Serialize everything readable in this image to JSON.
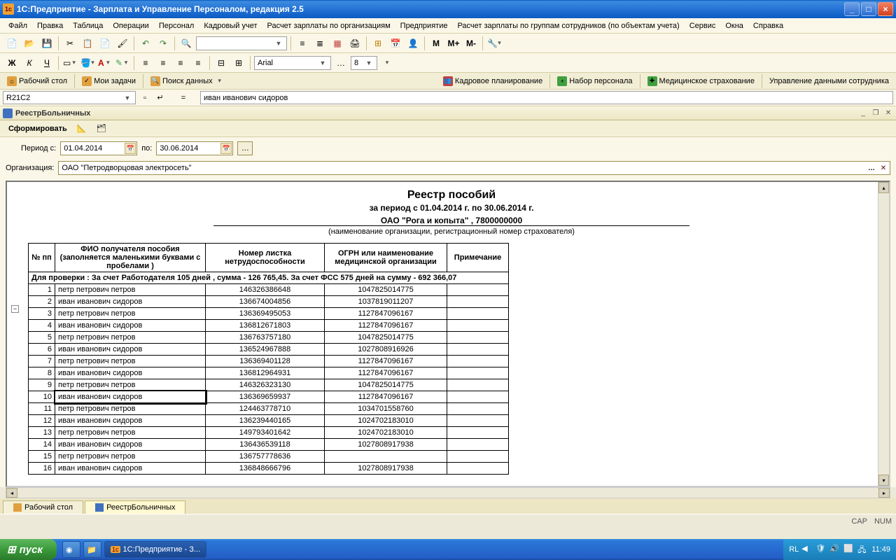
{
  "titlebar": {
    "text": "1С:Предприятие - Зарплата и Управление Персоналом, редакция 2.5"
  },
  "menu": {
    "items": [
      "Файл",
      "Правка",
      "Таблица",
      "Операции",
      "Персонал",
      "Кадровый учет",
      "Расчет зарплаты по организациям",
      "Предприятие",
      "Расчет зарплаты по группам сотрудников (по объектам учета)",
      "Сервис",
      "Окна",
      "Справка"
    ]
  },
  "fontcombo": {
    "name": "Arial",
    "size": "8"
  },
  "mtext": {
    "m": "M",
    "mplus": "M+",
    "mminus": "M-"
  },
  "tabs": {
    "desktop": "Рабочий стол",
    "tasks": "Мои задачи",
    "search": "Поиск данных",
    "plan": "Кадровое планирование",
    "recruit": "Набор персонала",
    "insurance": "Медицинское страхование",
    "empmgmt": "Управление данными сотрудника"
  },
  "cell": {
    "ref": "R21C2",
    "formula": "иван иванович сидоров",
    "eq": "="
  },
  "subwin": {
    "title": "РеестрБольничных"
  },
  "formbar": {
    "generate": "Сформировать"
  },
  "period": {
    "label": "Период с:",
    "from": "01.04.2014",
    "to_label": "по:",
    "to": "30.06.2014"
  },
  "org": {
    "label": "Организация:",
    "value": "ОАО \"Петродворцовая электросеть\""
  },
  "report": {
    "title": "Реестр пособий",
    "subtitle": "за период с 01.04.2014 г. по 30.06.2014 г.",
    "company": "ОАО \"Рога и копыта\" , 7800000000",
    "company_desc": "(наименование организации, регистрационный номер страхователя)",
    "headers": {
      "num": "№ пп",
      "fio": "ФИО  получателя пособия (заполняется маленькими буквами с пробелами )",
      "leaf": "Номер  листка нетрудоспособности",
      "ogrn": "ОГРН или наименование медицинской организации",
      "note": "Примечание"
    },
    "checkrow": "Для проверки : За счет Работодателя 105 дней , сумма - 126 765,45.  За счет ФСС 575 дней на сумму - 692 366,07",
    "rows": [
      {
        "n": "1",
        "fio": "петр петрович петров",
        "leaf": "146326386648",
        "ogrn": "1047825014775",
        "note": ""
      },
      {
        "n": "2",
        "fio": "иван иванович сидоров",
        "leaf": "136674004856",
        "ogrn": "1037819011207",
        "note": ""
      },
      {
        "n": "3",
        "fio": "петр петрович петров",
        "leaf": "136369495053",
        "ogrn": "1127847096167",
        "note": ""
      },
      {
        "n": "4",
        "fio": "иван иванович сидоров",
        "leaf": "136812671803",
        "ogrn": "1127847096167",
        "note": ""
      },
      {
        "n": "5",
        "fio": "петр петрович петров",
        "leaf": "136763757180",
        "ogrn": "1047825014775",
        "note": ""
      },
      {
        "n": "6",
        "fio": "иван иванович сидоров",
        "leaf": "136524967888",
        "ogrn": "1027808916926",
        "note": ""
      },
      {
        "n": "7",
        "fio": "петр петрович петров",
        "leaf": "136369401128",
        "ogrn": "1127847096167",
        "note": ""
      },
      {
        "n": "8",
        "fio": "иван иванович сидоров",
        "leaf": "136812964931",
        "ogrn": "1127847096167",
        "note": ""
      },
      {
        "n": "9",
        "fio": "петр петрович петров",
        "leaf": "146326323130",
        "ogrn": "1047825014775",
        "note": ""
      },
      {
        "n": "10",
        "fio": "иван иванович сидоров",
        "leaf": "136369659937",
        "ogrn": "1127847096167",
        "note": ""
      },
      {
        "n": "11",
        "fio": "петр петрович петров",
        "leaf": "124463778710",
        "ogrn": "1034701558760",
        "note": ""
      },
      {
        "n": "12",
        "fio": "иван иванович сидоров",
        "leaf": "136239440165",
        "ogrn": "1024702183010",
        "note": ""
      },
      {
        "n": "13",
        "fio": "петр петрович петров",
        "leaf": "149793401642",
        "ogrn": "1024702183010",
        "note": ""
      },
      {
        "n": "14",
        "fio": "иван иванович сидоров",
        "leaf": "136436539118",
        "ogrn": "1027808917938",
        "note": ""
      },
      {
        "n": "15",
        "fio": "петр петрович петров",
        "leaf": "136757778636",
        "ogrn": "",
        "note": ""
      },
      {
        "n": "16",
        "fio": "иван иванович сидоров",
        "leaf": "136848666796",
        "ogrn": "1027808917938",
        "note": ""
      }
    ]
  },
  "bottom_tabs": {
    "desktop": "Рабочий стол",
    "reg": "РеестрБольничных"
  },
  "status": {
    "cap": "CAP",
    "num": "NUM"
  },
  "taskbar": {
    "start": "пуск",
    "app": "1С:Предприятие - З...",
    "lang": "RL",
    "time": "11:49"
  }
}
